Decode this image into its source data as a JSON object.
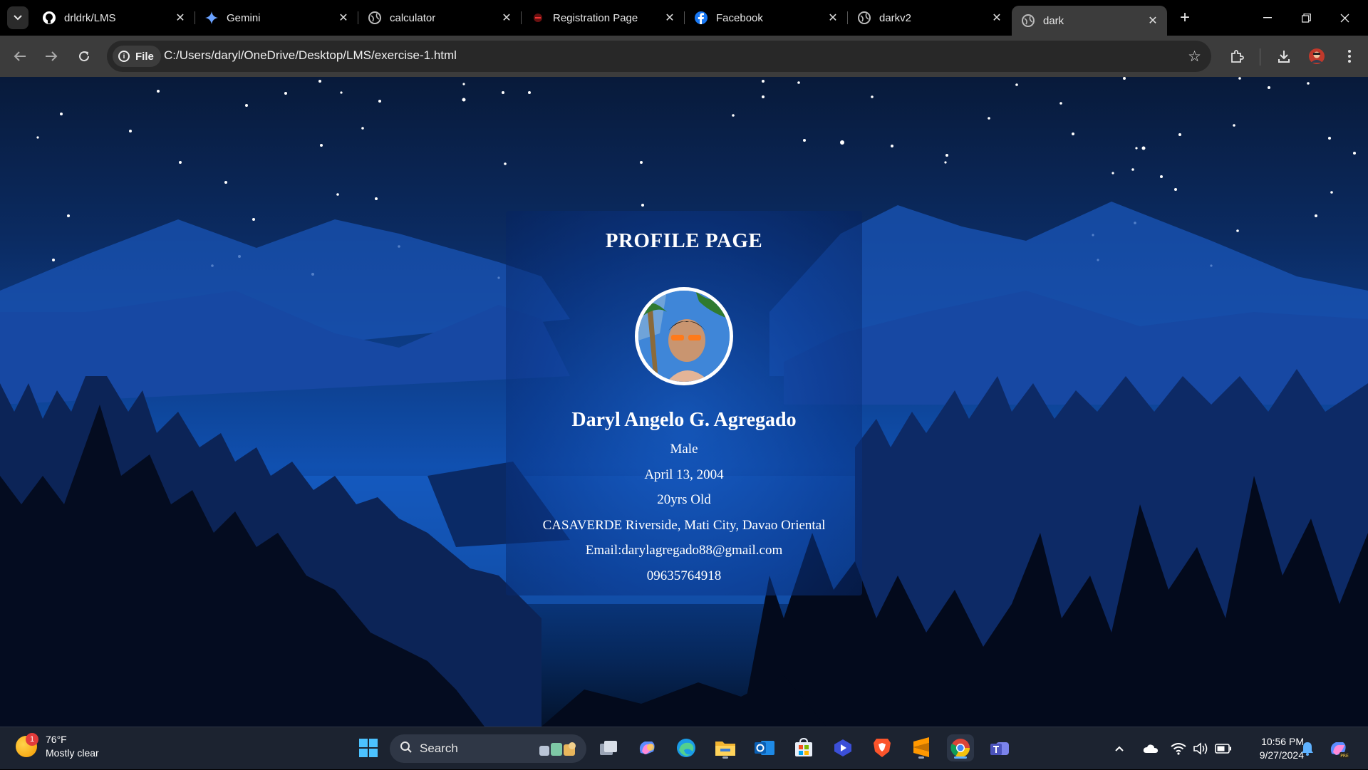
{
  "browser": {
    "tabs": [
      {
        "title": "drldrk/LMS",
        "icon": "github-icon"
      },
      {
        "title": "Gemini",
        "icon": "gemini-icon"
      },
      {
        "title": "calculator",
        "icon": "globe-icon"
      },
      {
        "title": "Registration Page",
        "icon": "page-icon"
      },
      {
        "title": "Facebook",
        "icon": "facebook-icon"
      },
      {
        "title": "darkv2",
        "icon": "globe-icon"
      },
      {
        "title": "dark",
        "icon": "globe-icon",
        "active": true
      }
    ],
    "address": {
      "scheme_chip": "File",
      "url": "C:/Users/daryl/OneDrive/Desktop/LMS/exercise-1.html"
    }
  },
  "profile": {
    "heading": "PROFILE PAGE",
    "name": "Daryl Angelo G. Agregado",
    "gender": "Male",
    "birthdate": "April 13, 2004",
    "age": "20yrs Old",
    "address": "CASAVERDE Riverside, Mati City, Davao Oriental",
    "email": "Email:darylagregado88@gmail.com",
    "phone": "09635764918"
  },
  "taskbar": {
    "weather": {
      "temp": "76°F",
      "condition": "Mostly clear",
      "badge": "1"
    },
    "search_label": "Search",
    "clock": {
      "time": "10:56 PM",
      "date": "9/27/2024"
    }
  },
  "colors": {
    "accent": "#5fb2ff",
    "tab_active": "#3c3c3c",
    "taskbar": "#1c2330"
  }
}
